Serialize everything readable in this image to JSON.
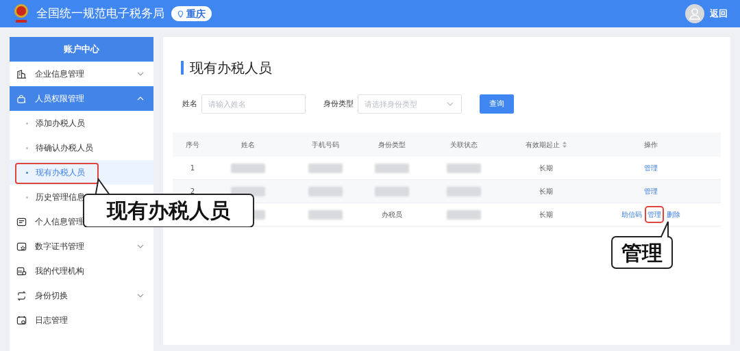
{
  "header": {
    "title": "全国统一规范电子税务局",
    "region": "重庆",
    "back": "返回"
  },
  "sidebar": {
    "title": "账户中心",
    "items": [
      {
        "label": "企业信息管理",
        "expanded": false,
        "selected": false
      },
      {
        "label": "人员权限管理",
        "expanded": true,
        "selected": true,
        "children": [
          {
            "label": "添加办税人员",
            "selected": false
          },
          {
            "label": "待确认办税人员",
            "selected": false
          },
          {
            "label": "现有办税人员",
            "selected": true
          },
          {
            "label": "历史管理信息",
            "selected": false
          }
        ]
      },
      {
        "label": "个人信息管理",
        "selected": false
      },
      {
        "label": "数字证书管理",
        "expanded": false,
        "selected": false
      },
      {
        "label": "我的代理机构",
        "selected": false
      },
      {
        "label": "身份切换",
        "expanded": false,
        "selected": false
      },
      {
        "label": "日志管理",
        "selected": false
      }
    ]
  },
  "main": {
    "title": "现有办税人员",
    "filters": [
      {
        "kind": "text",
        "label": "姓名",
        "placeholder": "请输入姓名"
      },
      {
        "kind": "select",
        "label": "身份类型",
        "placeholder": "请选择身份类型"
      }
    ],
    "query_button": "查询",
    "table": {
      "columns": [
        {
          "label": "序号"
        },
        {
          "label": "姓名"
        },
        {
          "label": "手机号码"
        },
        {
          "label": "身份类型"
        },
        {
          "label": "关联状态"
        },
        {
          "label": "有效期起止",
          "sortable": true
        },
        {
          "label": "操作"
        }
      ],
      "rows": [
        {
          "cells": [
            {
              "kind": "text",
              "text": "1"
            },
            {
              "kind": "redacted"
            },
            {
              "kind": "redacted"
            },
            {
              "kind": "redacted"
            },
            {
              "kind": "redacted"
            },
            {
              "kind": "text",
              "text": "长期"
            },
            {
              "kind": "actions",
              "actions": [
                {
                  "label": "管理",
                  "highlighted": false
                }
              ]
            }
          ]
        },
        {
          "cells": [
            {
              "kind": "text",
              "text": "2"
            },
            {
              "kind": "redacted"
            },
            {
              "kind": "redacted"
            },
            {
              "kind": "redacted"
            },
            {
              "kind": "redacted"
            },
            {
              "kind": "text",
              "text": "长期"
            },
            {
              "kind": "actions",
              "actions": [
                {
                  "label": "管理",
                  "highlighted": false
                }
              ]
            }
          ]
        },
        {
          "cells": [
            {
              "kind": "covered"
            },
            {
              "kind": "redacted"
            },
            {
              "kind": "redacted"
            },
            {
              "kind": "text",
              "text": "办税员"
            },
            {
              "kind": "redacted"
            },
            {
              "kind": "text",
              "text": "长期"
            },
            {
              "kind": "actions",
              "actions": [
                {
                  "label": "助信码",
                  "highlighted": false
                },
                {
                  "label": "管理",
                  "highlighted": true
                },
                {
                  "label": "删除",
                  "highlighted": false
                }
              ]
            }
          ]
        }
      ]
    }
  },
  "callouts": [
    {
      "text": "现有办税人员"
    },
    {
      "text": "管理"
    }
  ]
}
